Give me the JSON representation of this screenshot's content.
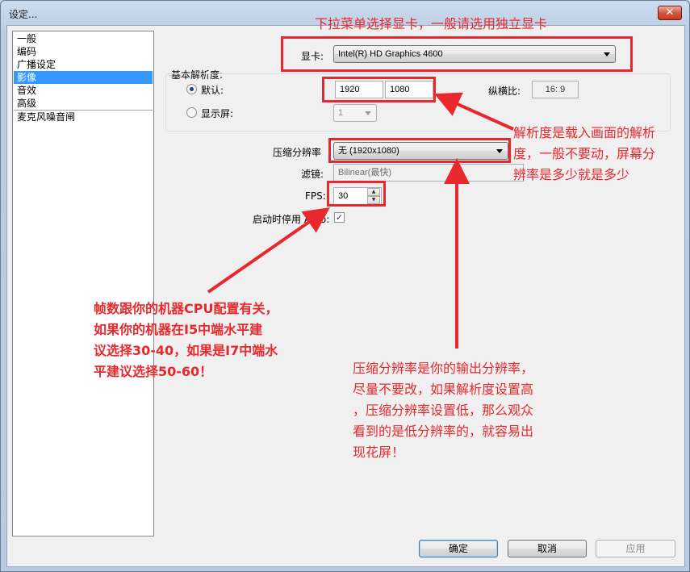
{
  "window": {
    "title": "设定...",
    "close_glyph": "✕"
  },
  "sidebar": {
    "items": [
      {
        "label": "一般"
      },
      {
        "label": "编码"
      },
      {
        "label": "广播设定"
      },
      {
        "label": "影像",
        "selected": true
      },
      {
        "label": "音效"
      },
      {
        "label": "高级"
      },
      {
        "label": "麦克风噪音闸"
      }
    ]
  },
  "video": {
    "adapter_label": "显卡:",
    "adapter_value": "Intel(R) HD Graphics 4600",
    "base_res_label": "基本解析度:",
    "default_label": "默认:",
    "width": "1920",
    "height": "1080",
    "aspect_label": "纵横比:",
    "aspect_value": "16:  9",
    "monitor_label": "显示屏:",
    "monitor_value": "1",
    "downscale_label": "压缩分辨率",
    "downscale_value": "无  (1920x1080)",
    "filter_label": "滤镜:",
    "filter_value": "Bilinear(最快)",
    "fps_label": "FPS:",
    "fps_value": "30",
    "aero_label": "启动时停用 Aero:",
    "aero_checked": true
  },
  "buttons": {
    "ok": "确定",
    "cancel": "取消",
    "apply": "应用"
  },
  "annotations": {
    "adapter_note": "下拉菜单选择显卡，一般请选用独立显卡",
    "resolution_note": [
      "解析度是载入画面的解析",
      "度，一般不要动，屏幕分",
      "辨率是多少就是多少"
    ],
    "fps_note": [
      "帧数跟你的机器CPU配置有关，",
      "如果你的机器在I5中端水平建",
      "议选择30-40，如果是I7中端水",
      "平建议选择50-60！"
    ],
    "downscale_note": [
      "压缩分辨率是你的输出分辨率，",
      "尽量不要改，如果解析度设置高",
      "，压缩分辨率设置低，那么观众",
      "看到的是低分辨率的，就容易出",
      "现花屏！"
    ]
  },
  "colors": {
    "annotation": "#e8282d",
    "selection": "#3399ff"
  }
}
